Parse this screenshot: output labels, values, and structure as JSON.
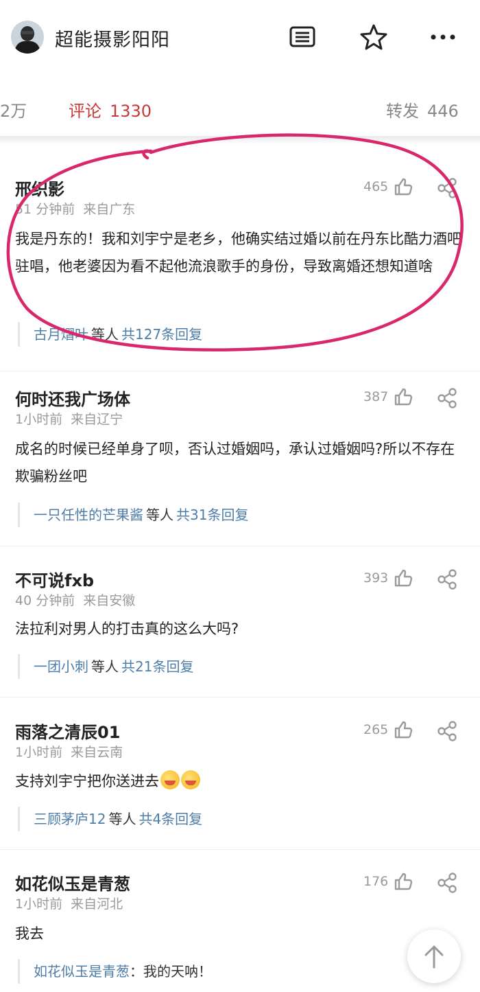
{
  "header": {
    "title": "超能摄影阳阳",
    "icons": [
      "avatar",
      "menu-card-icon",
      "star-icon",
      "more-icon"
    ]
  },
  "tabs": {
    "left_partial": "2万",
    "comments": {
      "label": "评论",
      "count": "1330"
    },
    "reposts": {
      "label": "转发",
      "count": "446"
    },
    "accent_color": "#c73a3a"
  },
  "comments": [
    {
      "name": "邢织影",
      "time": "51 分钟前",
      "location": "来自广东",
      "likes": "465",
      "text": "我是丹东的！我和刘宇宁是老乡，他确实结过婚以前在丹东比酷力酒吧驻唱，他老婆因为看不起他流浪歌手的身份，导致离婚还想知道啥",
      "reply_user": "古月熠叶",
      "reply_etc": "等人",
      "reply_total": "共127条回复"
    },
    {
      "name": "何时还我广场体",
      "time": "1小时前",
      "location": "来自辽宁",
      "likes": "387",
      "text": "成名的时候已经单身了呗，否认过婚姻吗，承认过婚姻吗?所以不存在欺骗粉丝吧",
      "reply_user": "一只任性的芒果酱",
      "reply_etc": "等人",
      "reply_total": "共31条回复"
    },
    {
      "name": "不可说fxb",
      "time": "40 分钟前",
      "location": "来自安徽",
      "likes": "393",
      "text": "法拉利对男人的打击真的这么大吗?",
      "reply_user": "一团小刺",
      "reply_etc": "等人",
      "reply_total": "共21条回复"
    },
    {
      "name": "雨落之清辰01",
      "time": "1小时前",
      "location": "来自云南",
      "likes": "265",
      "text": "支持刘宇宁把你送进去",
      "reply_user": "三顾茅庐12",
      "reply_etc": "等人",
      "reply_total": "共4条回复"
    },
    {
      "name": "如花似玉是青葱",
      "time": "1小时前",
      "location": "来自河北",
      "likes": "176",
      "text": "我去",
      "reply_user": "如花似玉是青葱",
      "reply_sep": "：",
      "reply_text": "我的天呐！"
    }
  ]
}
